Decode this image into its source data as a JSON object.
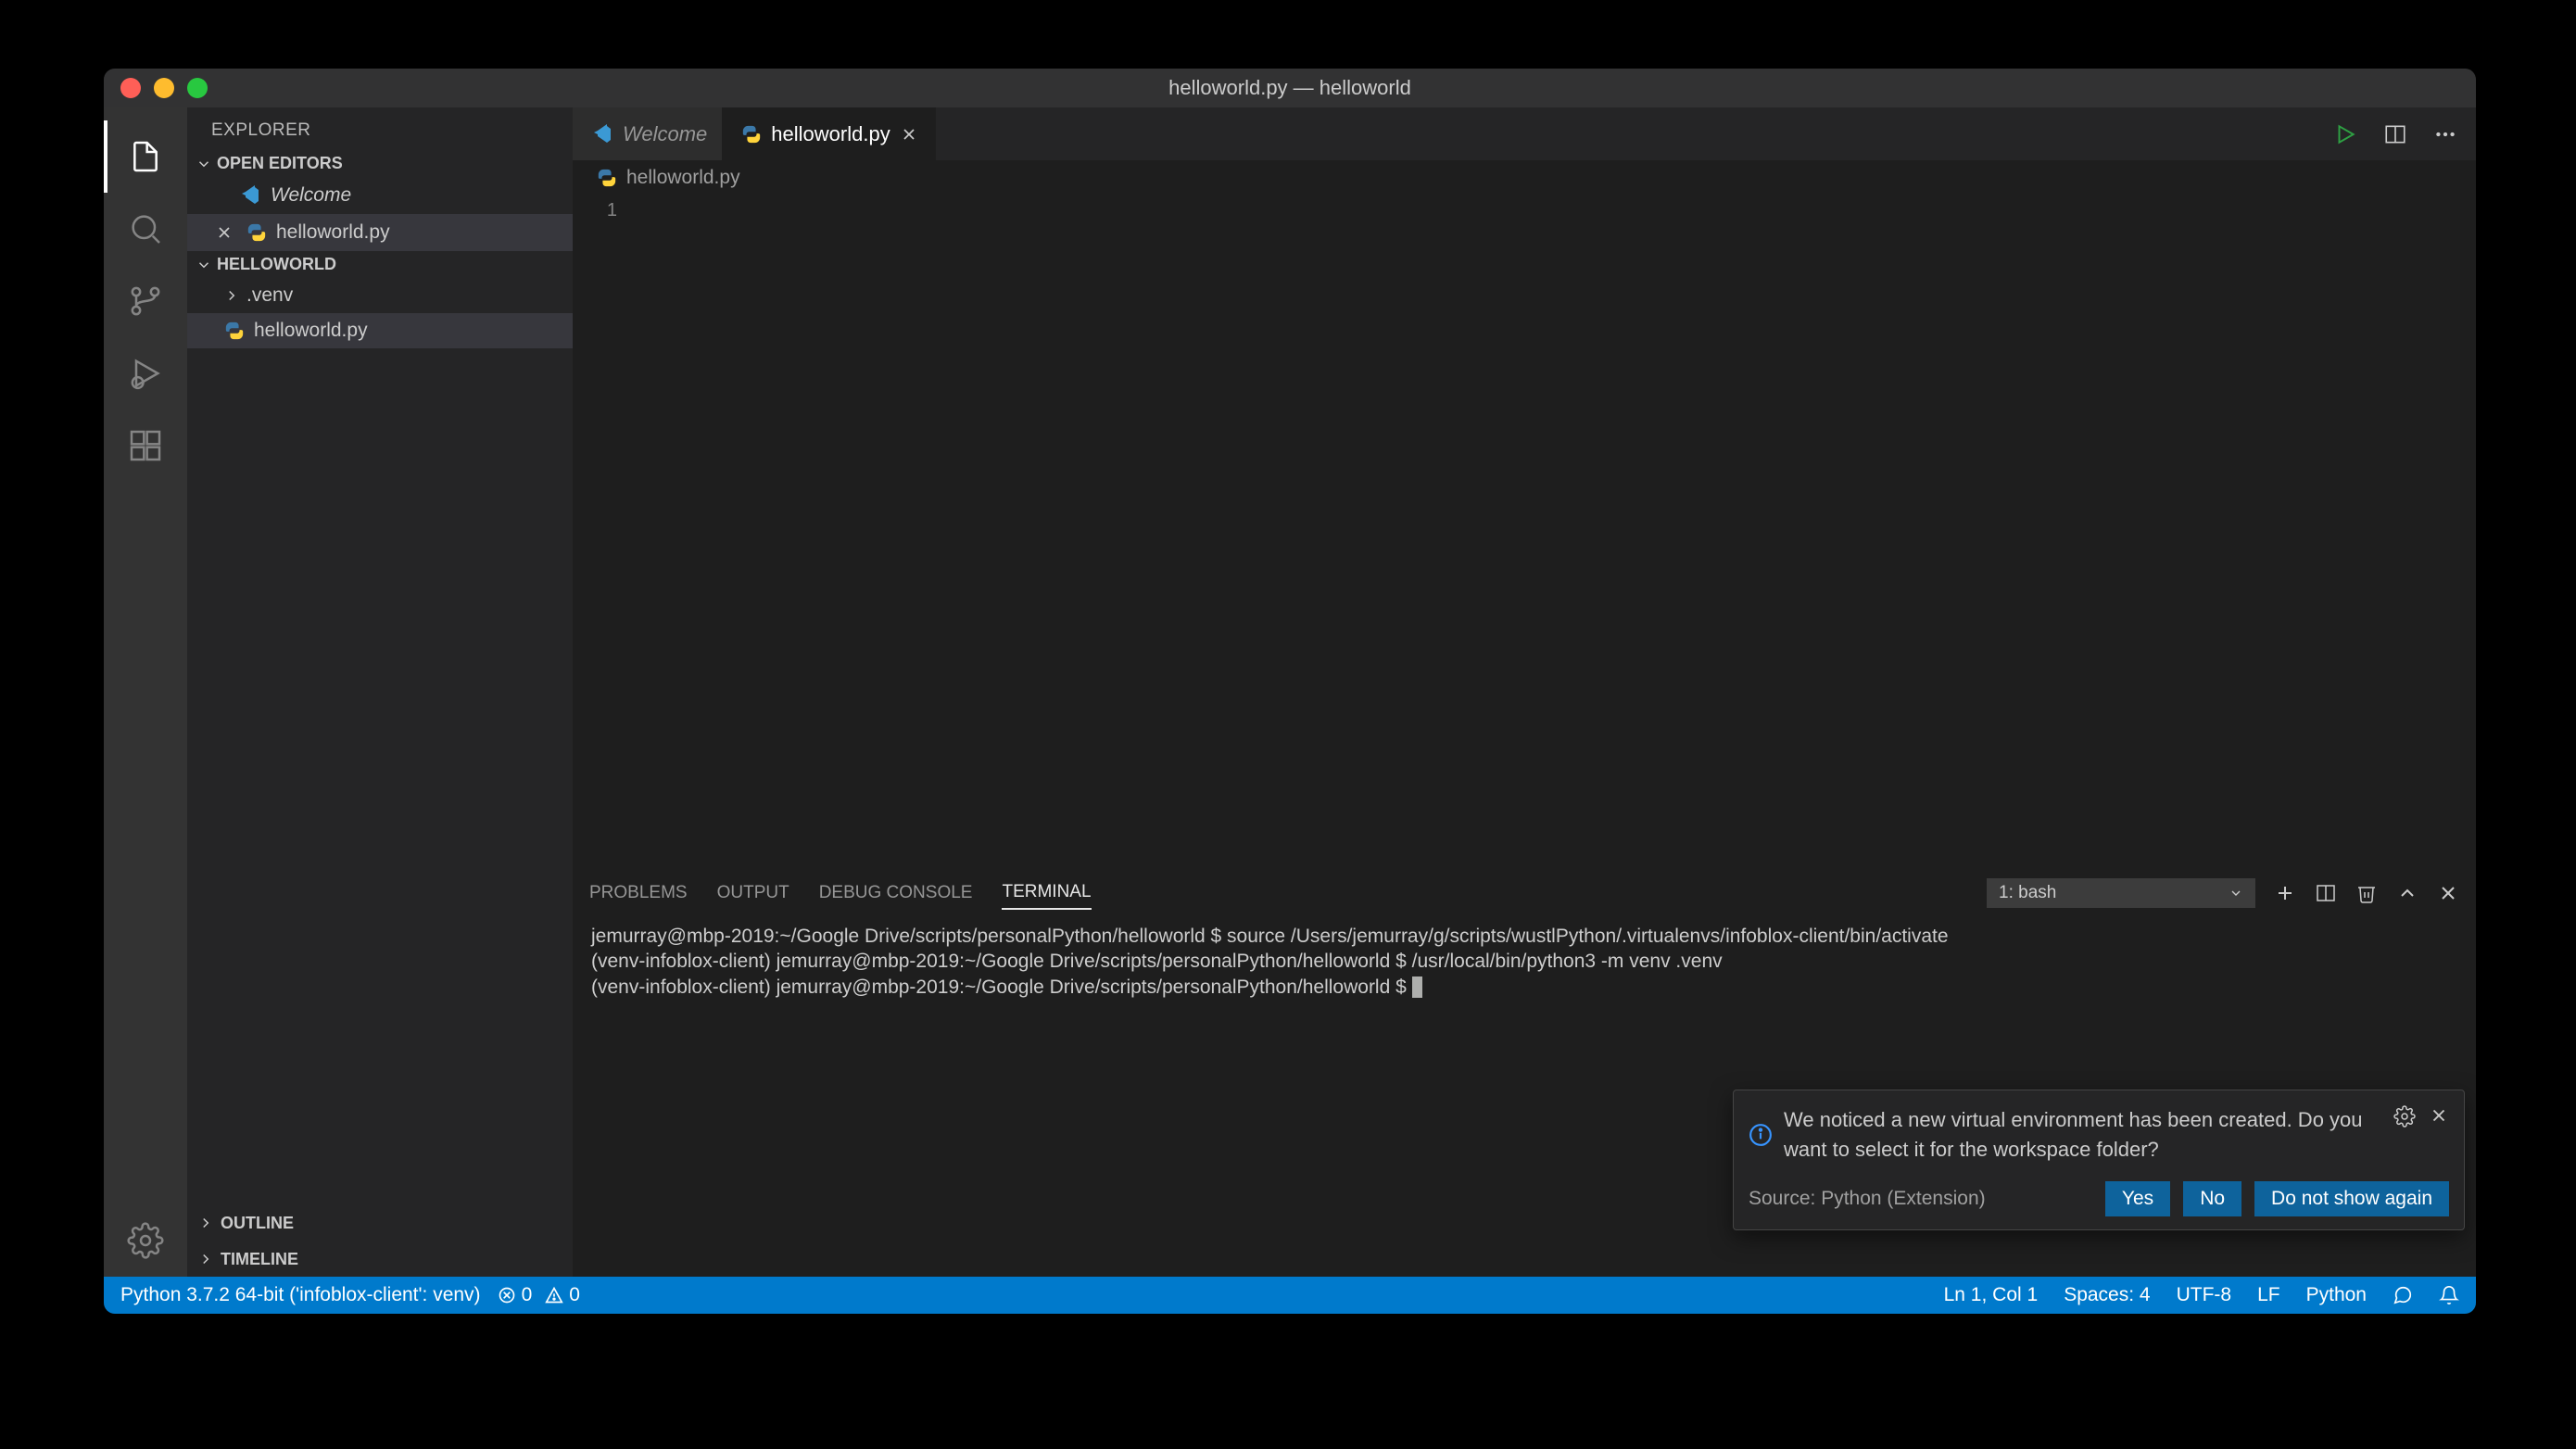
{
  "window": {
    "title": "helloworld.py — helloworld"
  },
  "sidebar": {
    "title": "EXPLORER",
    "open_editors_label": "OPEN EDITORS",
    "workspace_label": "HELLOWORLD",
    "open_editors": [
      {
        "label": "Welcome",
        "icon": "vscode-icon",
        "italic": true,
        "closeable": false
      },
      {
        "label": "helloworld.py",
        "icon": "python-icon",
        "italic": false,
        "closeable": true
      }
    ],
    "tree": {
      "folders": [
        {
          "label": ".venv",
          "expanded": false
        }
      ],
      "files": [
        {
          "label": "helloworld.py",
          "icon": "python-icon",
          "active": true
        }
      ]
    },
    "outline_label": "OUTLINE",
    "timeline_label": "TIMELINE"
  },
  "tabs": [
    {
      "label": "Welcome",
      "icon": "vscode-icon",
      "active": false,
      "italic": true
    },
    {
      "label": "helloworld.py",
      "icon": "python-icon",
      "active": true,
      "italic": false
    }
  ],
  "breadcrumb": {
    "file": "helloworld.py"
  },
  "editor": {
    "line_number": "1",
    "content": ""
  },
  "panel": {
    "tabs": [
      "PROBLEMS",
      "OUTPUT",
      "DEBUG CONSOLE",
      "TERMINAL"
    ],
    "active_tab": "TERMINAL",
    "terminal_selector": "1: bash",
    "terminal_lines": [
      "jemurray@mbp-2019:~/Google Drive/scripts/personalPython/helloworld $ source /Users/jemurray/g/scripts/wustlPython/.virtualenvs/infoblox-client/bin/activate",
      "(venv-infoblox-client) jemurray@mbp-2019:~/Google Drive/scripts/personalPython/helloworld $ /usr/local/bin/python3 -m venv .venv",
      "(venv-infoblox-client) jemurray@mbp-2019:~/Google Drive/scripts/personalPython/helloworld $ "
    ]
  },
  "notification": {
    "message": "We noticed a new virtual environment has been created. Do you want to select it for the workspace folder?",
    "source": "Source: Python (Extension)",
    "buttons": {
      "yes": "Yes",
      "no": "No",
      "never": "Do not show again"
    }
  },
  "statusbar": {
    "interpreter": "Python 3.7.2 64-bit ('infoblox-client': venv)",
    "errors": "0",
    "warnings": "0",
    "cursor": "Ln 1, Col 1",
    "spaces": "Spaces: 4",
    "encoding": "UTF-8",
    "eol": "LF",
    "language": "Python"
  }
}
